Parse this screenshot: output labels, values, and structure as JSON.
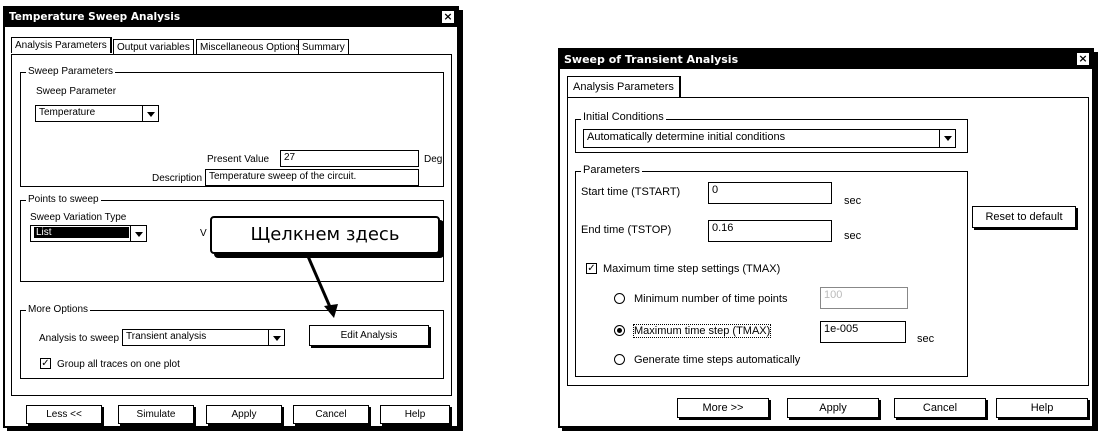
{
  "left_dialog": {
    "title": "Temperature Sweep Analysis",
    "close_glyph": "×",
    "tabs": [
      "Analysis Parameters",
      "Output variables",
      "Miscellaneous Options",
      "Summary"
    ],
    "sweep_parameters": {
      "group_label": "Sweep Parameters",
      "param_label": "Sweep Parameter",
      "param_value": "Temperature",
      "present_value_label": "Present Value",
      "present_value": "27",
      "unit": "Deg",
      "description_label": "Description",
      "description_value": "Temperature sweep of the circuit."
    },
    "points": {
      "group_label": "Points to sweep",
      "variation_label": "Sweep Variation Type",
      "variation_value": "List",
      "value_label_partial": "V"
    },
    "more_options": {
      "group_label": "More Options",
      "analysis_label": "Analysis to sweep",
      "analysis_value": "Transient analysis",
      "edit_button": "Edit Analysis",
      "group_traces_label": "Group all traces on one plot",
      "group_traces_checked": true
    },
    "buttons": [
      "Less <<",
      "Simulate",
      "Apply",
      "Cancel",
      "Help"
    ]
  },
  "callout": {
    "text": "Щелкнем здесь"
  },
  "right_dialog": {
    "title": "Sweep of Transient Analysis",
    "close_glyph": "×",
    "tab": "Analysis Parameters",
    "initial_conditions": {
      "group_label": "Initial Conditions",
      "value": "Automatically determine initial conditions"
    },
    "parameters": {
      "group_label": "Parameters",
      "start_label": "Start time (TSTART)",
      "start_value": "0",
      "end_label": "End time (TSTOP)",
      "end_value": "0.16",
      "unit": "sec",
      "tmax_settings_label": "Maximum time step settings (TMAX)",
      "tmax_settings_checked": true,
      "min_points_label": "Minimum number of time points",
      "min_points_value": "100",
      "max_step_label": "Maximum time step (TMAX)",
      "max_step_value": "1e-005",
      "auto_steps_label": "Generate time steps automatically",
      "selected_option": "max_step"
    },
    "reset_button": "Reset to default",
    "buttons": [
      "More >>",
      "Apply",
      "Cancel",
      "Help"
    ]
  }
}
